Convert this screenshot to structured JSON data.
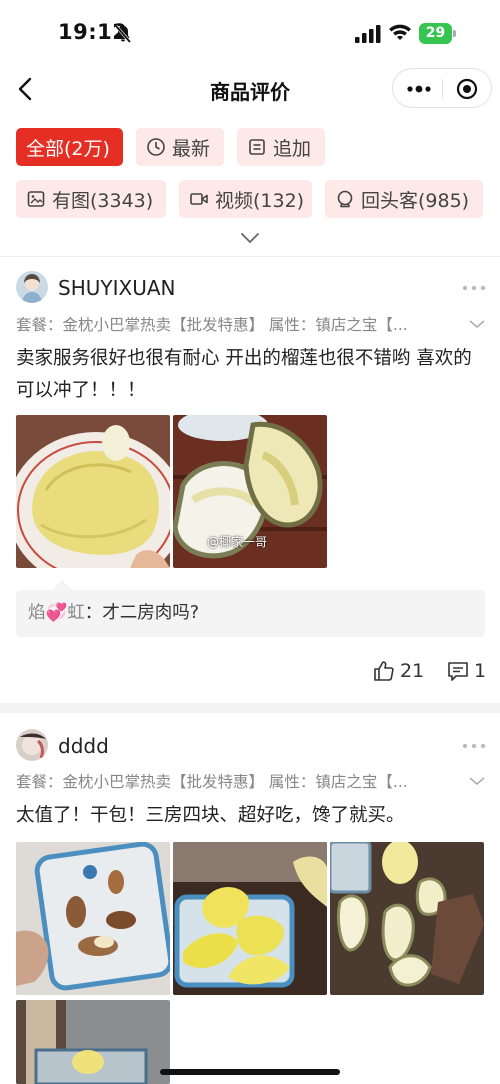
{
  "status": {
    "time": "19:12",
    "battery": "29"
  },
  "nav": {
    "title": "商品评价"
  },
  "filters": [
    {
      "label": "全部(2万)",
      "icon": "none",
      "active": true
    },
    {
      "label": "最新",
      "icon": "clock-icon",
      "active": false
    },
    {
      "label": "追加",
      "icon": "note-icon",
      "active": false
    },
    {
      "label": "有图(3343)",
      "icon": "image-icon",
      "active": false
    },
    {
      "label": "视频(132)",
      "icon": "video-icon",
      "active": false
    },
    {
      "label": "回头客(985)",
      "icon": "return-customer-icon",
      "active": false
    }
  ],
  "reviews": [
    {
      "username": "SHUYIXUAN",
      "meta": "套餐：金枕小巴掌热卖【批发特惠】 属性：镇店之宝【...",
      "text": "卖家服务很好也很有耐心 开出的榴莲也很不错哟 喜欢的可以冲了！！！",
      "photo_watermark": "@椰家一哥",
      "reply": {
        "name": "焰💞虹",
        "text": "：才二房肉吗?"
      },
      "likes": "21",
      "comments": "1"
    },
    {
      "username": "dddd",
      "meta": "套餐：金枕小巴掌热卖【批发特惠】 属性：镇店之宝【...",
      "text": "太值了！干包！三房四块、超好吃，馋了就买。"
    }
  ],
  "colors": {
    "accent": "#e62f24",
    "chip_bg": "#fde9e7",
    "battery": "#37c450"
  }
}
